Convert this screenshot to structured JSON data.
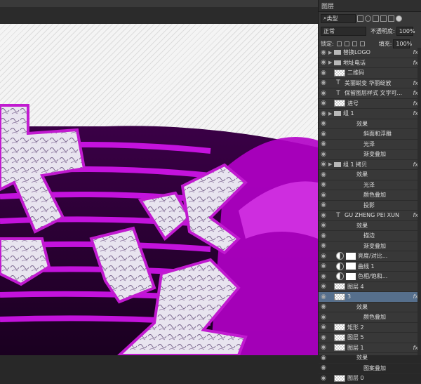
{
  "panel": {
    "tab_label": "图层",
    "filter_label": "类型",
    "blend_mode": "正常",
    "opacity_label": "不透明度:",
    "opacity_value": "100%",
    "lock_label": "锁定:",
    "fill_label": "填充:",
    "fill_value": "100%"
  },
  "layers": [
    {
      "type": "group",
      "name": "替换LOGO",
      "fx": "fx"
    },
    {
      "type": "group",
      "name": "地址电话",
      "fx": "fx"
    },
    {
      "type": "pixel",
      "name": "二维码",
      "fx": ""
    },
    {
      "type": "text",
      "name": "美丽蜕变  华丽绽放",
      "fx": "fx"
    },
    {
      "type": "text",
      "name": "保留图层样式  文字可...",
      "fx": "fx"
    },
    {
      "type": "pixel",
      "name": "进号",
      "fx": "fx"
    },
    {
      "type": "group",
      "name": "组 1",
      "fx": "fx"
    },
    {
      "type": "effects",
      "name": "效果"
    },
    {
      "type": "effect",
      "name": "斜面和浮雕"
    },
    {
      "type": "effect",
      "name": "光泽"
    },
    {
      "type": "effect",
      "name": "渐变叠加"
    },
    {
      "type": "group",
      "name": "组 1 拷贝",
      "fx": "fx"
    },
    {
      "type": "effects",
      "name": "效果"
    },
    {
      "type": "effect",
      "name": "光泽"
    },
    {
      "type": "effect",
      "name": "颜色叠加"
    },
    {
      "type": "effect",
      "name": "投影"
    },
    {
      "type": "text",
      "name": "GU ZHENG PEI XUN",
      "fx": "fx"
    },
    {
      "type": "effects",
      "name": "效果"
    },
    {
      "type": "effect",
      "name": "描边"
    },
    {
      "type": "effect",
      "name": "渐变叠加"
    },
    {
      "type": "adjust",
      "name": "亮度/对比..."
    },
    {
      "type": "adjust",
      "name": "曲线 1"
    },
    {
      "type": "adjust",
      "name": "色相/饱和..."
    },
    {
      "type": "pixel",
      "name": "图层 4",
      "fx": ""
    },
    {
      "type": "pixel",
      "name": "3",
      "fx": "fx",
      "selected": true
    },
    {
      "type": "effects",
      "name": "效果"
    },
    {
      "type": "effect",
      "name": "颜色叠加"
    },
    {
      "type": "pixel",
      "name": "矩形 2",
      "fx": ""
    },
    {
      "type": "pixel",
      "name": "图层 5",
      "fx": ""
    },
    {
      "type": "pixel",
      "name": "图层 1",
      "fx": "fx"
    },
    {
      "type": "effects",
      "name": "效果"
    },
    {
      "type": "effect",
      "name": "图案叠加"
    },
    {
      "type": "pixel",
      "name": "图层 0",
      "fx": ""
    }
  ]
}
